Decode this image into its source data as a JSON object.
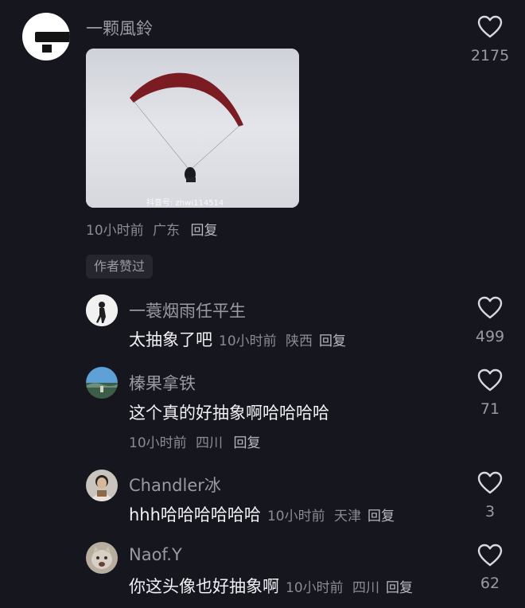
{
  "main_comment": {
    "username": "一颗風鈴",
    "likes": "2175",
    "time": "10小时前",
    "location": "广东",
    "reply_label": "回复",
    "video_watermark": "抖音号: zhwi114514"
  },
  "author_liked_label": "作者赞过",
  "replies": [
    {
      "username": "一蓑烟雨任平生",
      "text": "太抽象了吧",
      "time": "10小时前",
      "location": "陕西",
      "reply_label": "回复",
      "likes": "499"
    },
    {
      "username": "榛果拿铁",
      "text": "这个真的好抽象啊哈哈哈哈",
      "time": "10小时前",
      "location": "四川",
      "reply_label": "回复",
      "likes": "71"
    },
    {
      "username": "Chandler冰",
      "text": "hhh哈哈哈哈哈哈",
      "time": "10小时前",
      "location": "天津",
      "reply_label": "回复",
      "likes": "3"
    },
    {
      "username": "Naof.Y",
      "text": "你这头像也好抽象啊",
      "time": "10小时前",
      "location": "四川",
      "reply_label": "回复",
      "likes": "62"
    }
  ],
  "icons": {
    "like": "heart-outline-icon"
  }
}
